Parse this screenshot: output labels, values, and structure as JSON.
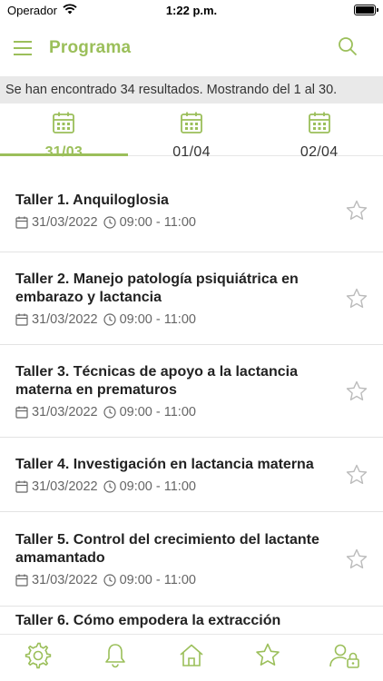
{
  "status_bar": {
    "carrier": "Operador",
    "time": "1:22 p.m."
  },
  "header": {
    "title": "Programa",
    "menu_icon": "menu-icon",
    "search_icon": "search-icon"
  },
  "results": {
    "text": "Se han encontrado 34 resultados. Mostrando del 1 al 30."
  },
  "date_tabs": [
    {
      "label": "31/03",
      "active": true
    },
    {
      "label": "01/04",
      "active": false
    },
    {
      "label": "02/04",
      "active": false
    }
  ],
  "sessions": [
    {
      "title": "Taller 1. Anquiloglosia",
      "date": "31/03/2022",
      "time": "09:00 - 11:00"
    },
    {
      "title": "Taller 2. Manejo patología psiquiátrica en embarazo y lactancia",
      "date": "31/03/2022",
      "time": "09:00 - 11:00"
    },
    {
      "title": "Taller 3. Técnicas de apoyo a la lactancia materna en prematuros",
      "date": "31/03/2022",
      "time": "09:00 - 11:00"
    },
    {
      "title": "Taller 4. Investigación en lactancia materna",
      "date": "31/03/2022",
      "time": "09:00 - 11:00"
    },
    {
      "title": "Taller 5. Control del crecimiento del lactante amamantado",
      "date": "31/03/2022",
      "time": "09:00 - 11:00"
    },
    {
      "title": "Taller 6. Cómo empodera la extracción",
      "date": "",
      "time": ""
    }
  ],
  "bottom_nav": [
    {
      "name": "settings",
      "icon": "gear-icon"
    },
    {
      "name": "notifications",
      "icon": "bell-icon"
    },
    {
      "name": "home",
      "icon": "home-icon"
    },
    {
      "name": "favorites",
      "icon": "star-icon"
    },
    {
      "name": "user-lock",
      "icon": "user-lock-icon"
    }
  ],
  "colors": {
    "accent": "#9bbf5a",
    "banner_bg": "#e9e9e9",
    "text": "#222222",
    "meta": "#666666"
  }
}
